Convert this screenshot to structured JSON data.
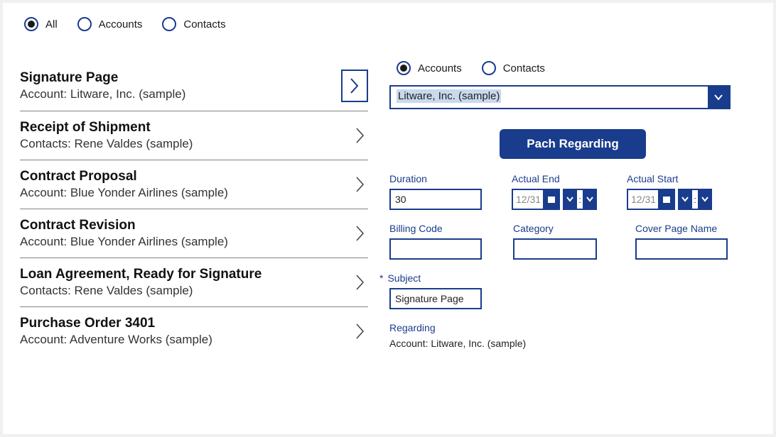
{
  "top_filter": {
    "options": [
      "All",
      "Accounts",
      "Contacts"
    ],
    "selected": "All"
  },
  "list": [
    {
      "title": "Signature Page",
      "sub": "Account: Litware, Inc. (sample)",
      "selected": true
    },
    {
      "title": "Receipt of Shipment",
      "sub": "Contacts: Rene Valdes (sample)",
      "selected": false
    },
    {
      "title": "Contract Proposal",
      "sub": "Account: Blue Yonder Airlines (sample)",
      "selected": false
    },
    {
      "title": "Contract Revision",
      "sub": "Account: Blue Yonder Airlines (sample)",
      "selected": false
    },
    {
      "title": "Loan Agreement, Ready for Signature",
      "sub": "Contacts: Rene Valdes (sample)",
      "selected": false
    },
    {
      "title": "Purchase Order 3401",
      "sub": "Account: Adventure Works (sample)",
      "selected": false
    }
  ],
  "detail": {
    "filter": {
      "options": [
        "Accounts",
        "Contacts"
      ],
      "selected": "Accounts"
    },
    "dropdown_value": "Litware, Inc. (sample)",
    "action_button": "Pach Regarding",
    "fields": {
      "duration": {
        "label": "Duration",
        "value": "30"
      },
      "actual_end": {
        "label": "Actual End",
        "date": "12/31"
      },
      "actual_start": {
        "label": "Actual Start",
        "date": "12/31"
      },
      "billing_code": {
        "label": "Billing Code",
        "value": ""
      },
      "category": {
        "label": "Category",
        "value": ""
      },
      "cover_page_name": {
        "label": "Cover Page Name",
        "value": ""
      },
      "subject": {
        "label": "Subject",
        "value": "Signature Page"
      },
      "regarding": {
        "label": "Regarding",
        "value": "Account: Litware, Inc. (sample)"
      }
    },
    "time_sep": ":"
  }
}
